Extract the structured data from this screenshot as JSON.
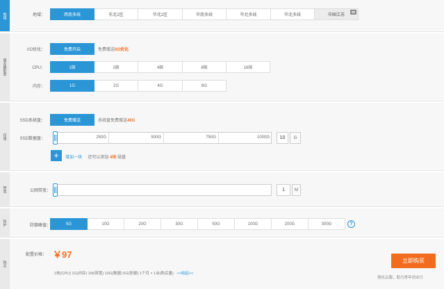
{
  "region": {
    "tag": "地域",
    "label": "地域：",
    "options": [
      "西南多线",
      "东北2区",
      "华北2区",
      "华南多线",
      "华北多线",
      "华北多线",
      "中国江苏"
    ],
    "selected": 0
  },
  "config": {
    "tag": "服务器配置",
    "io": {
      "label": "I/O优化：",
      "button": "免费开启",
      "hint_prefix": "免费赠送",
      "hint_highlight": "I/O优化"
    },
    "cpu": {
      "label": "CPU：",
      "options": [
        "1核",
        "2核",
        "4核",
        "8核",
        "16核"
      ],
      "selected": 0
    },
    "memory": {
      "label": "内存：",
      "options": [
        "1G",
        "2G",
        "4G",
        "8G"
      ],
      "selected": 0
    }
  },
  "storage": {
    "tag": "存储",
    "system_disk": {
      "label": "SSD系统盘：",
      "button": "免费赠送",
      "hint_prefix": "系统盘免费赠送",
      "hint_highlight": "40G"
    },
    "data_disk": {
      "label": "SSD数据盘：",
      "ticks": [
        "250G",
        "500G",
        "750G",
        "1000G"
      ],
      "value": "10",
      "unit": "G",
      "level_fraction": 0
    },
    "add": {
      "plus": "+",
      "link": "增加一块",
      "note_prefix": "还可以添加",
      "note_count": "4块",
      "note_suffix": "磁盘"
    }
  },
  "bandwidth": {
    "tag": "带宽",
    "label": "公网带宽：",
    "value": "1",
    "unit": "M",
    "level_fraction": 0
  },
  "defense": {
    "tag": "防护",
    "label": "防御峰值：",
    "options": [
      "5G",
      "10G",
      "20G",
      "30G",
      "50G",
      "100G",
      "200G",
      "300G"
    ],
    "selected": 0,
    "help": "?"
  },
  "purchase": {
    "tag": "购买",
    "label": "配置价格：",
    "price": "￥97",
    "summary": "1核(CPU) 1G(内存) 1M(带宽) 10G(数据) 5G(防御) 1个月 × 1台(购买量)",
    "detail_link": ">>收起<<",
    "buy_button": "立即购买",
    "footer": "强化云服，助力青年创业行"
  },
  "colors": {
    "accent": "#2a96d6",
    "orange": "#f26c1d"
  }
}
